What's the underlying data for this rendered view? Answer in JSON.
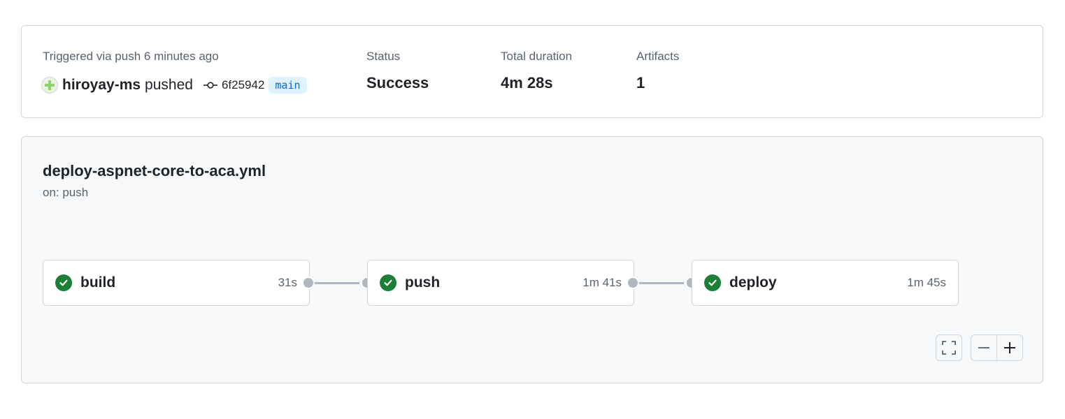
{
  "summary": {
    "trigger_label": "Triggered via push 6 minutes ago",
    "actor": "hiroyay-ms",
    "actor_verb": "pushed",
    "commit_sha": "6f25942",
    "branch": "main",
    "status_label": "Status",
    "status_value": "Success",
    "duration_label": "Total duration",
    "duration_value": "4m 28s",
    "artifacts_label": "Artifacts",
    "artifacts_value": "1"
  },
  "workflow": {
    "file": "deploy-aspnet-core-to-aca.yml",
    "trigger": "on: push",
    "jobs": [
      {
        "name": "build",
        "duration": "31s",
        "status": "success",
        "icon": "check-circle-icon"
      },
      {
        "name": "push",
        "duration": "1m 41s",
        "status": "success",
        "icon": "check-circle-icon"
      },
      {
        "name": "deploy",
        "duration": "1m 45s",
        "status": "success",
        "icon": "check-circle-icon"
      }
    ]
  },
  "controls": {
    "fullscreen_icon": "fullscreen-icon",
    "zoom_out_icon": "zoom-out-icon",
    "zoom_in_icon": "zoom-in-icon"
  },
  "colors": {
    "success": "#1a7f37",
    "branch_bg": "#ddf4ff",
    "branch_text": "#0969da",
    "connector": "#afb8c1"
  }
}
